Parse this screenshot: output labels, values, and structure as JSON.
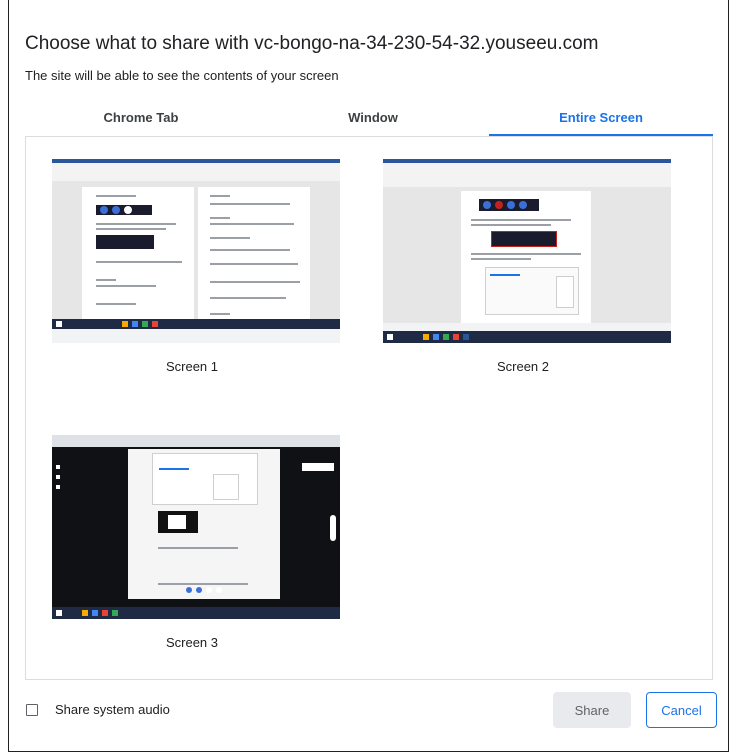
{
  "dialog": {
    "title": "Choose what to share with vc-bongo-na-34-230-54-32.youseeu.com",
    "subtitle": "The site will be able to see the contents of your screen"
  },
  "tabs": [
    {
      "label": "Chrome Tab",
      "selected": false
    },
    {
      "label": "Window",
      "selected": false
    },
    {
      "label": "Entire Screen",
      "selected": true
    }
  ],
  "screens": [
    {
      "label": "Screen 1"
    },
    {
      "label": "Screen 2"
    },
    {
      "label": "Screen 3"
    }
  ],
  "footer": {
    "audio_label": "Share system audio",
    "audio_checked": false,
    "share_label": "Share",
    "cancel_label": "Cancel"
  },
  "colors": {
    "accent": "#1a73e8",
    "text": "#202124",
    "disabled_button_bg": "#e8eaed",
    "border": "#dadce0"
  }
}
